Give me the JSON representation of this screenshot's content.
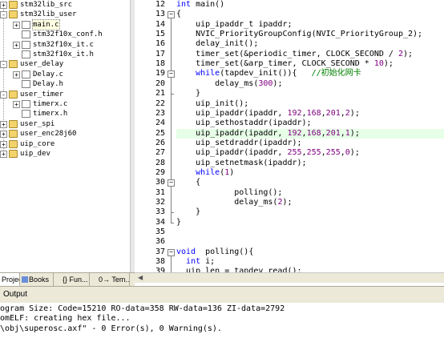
{
  "project_tree": [
    {
      "label": "stm32lib_src",
      "kind": "folder",
      "expand": "+",
      "depth": 0
    },
    {
      "label": "stm32lib_user",
      "kind": "folder",
      "expand": "-",
      "depth": 0
    },
    {
      "label": "main.c",
      "kind": "file",
      "expand": "+",
      "depth": 1,
      "selected": true
    },
    {
      "label": "stm32f10x_conf.h",
      "kind": "file",
      "expand": "",
      "depth": 1
    },
    {
      "label": "stm32f10x_it.c",
      "kind": "file",
      "expand": "+",
      "depth": 1
    },
    {
      "label": "stm32f10x_it.h",
      "kind": "file",
      "expand": "",
      "depth": 1
    },
    {
      "label": "user_delay",
      "kind": "folder",
      "expand": "-",
      "depth": 0
    },
    {
      "label": "Delay.c",
      "kind": "file",
      "expand": "+",
      "depth": 1
    },
    {
      "label": "Delay.h",
      "kind": "file",
      "expand": "",
      "depth": 1
    },
    {
      "label": "user_timer",
      "kind": "folder",
      "expand": "-",
      "depth": 0
    },
    {
      "label": "timerx.c",
      "kind": "file",
      "expand": "+",
      "depth": 1
    },
    {
      "label": "timerx.h",
      "kind": "file",
      "expand": "",
      "depth": 1
    },
    {
      "label": "user_spi",
      "kind": "folder",
      "expand": "+",
      "depth": 0
    },
    {
      "label": "user_enc28j60",
      "kind": "folder",
      "expand": "+",
      "depth": 0
    },
    {
      "label": "uip_core",
      "kind": "folder",
      "expand": "+",
      "depth": 0
    },
    {
      "label": "uip_dev",
      "kind": "folder",
      "expand": "+",
      "depth": 0
    }
  ],
  "panel_tabs": [
    {
      "label": "Project",
      "icon": "project-icon",
      "active": true
    },
    {
      "label": "Books",
      "icon": "books-icon",
      "active": false
    },
    {
      "label": "{} Fun...",
      "icon": "functions-icon",
      "active": false
    },
    {
      "label": "0→ Tem...",
      "icon": "templates-icon",
      "active": false
    }
  ],
  "editor": {
    "highlight_line": 25,
    "lines": [
      {
        "n": "12",
        "tokens": [
          [
            "kw",
            "int"
          ],
          [
            "t",
            " main()"
          ]
        ]
      },
      {
        "n": "13",
        "tokens": [
          [
            "t",
            "{"
          ]
        ]
      },
      {
        "n": "14",
        "tokens": [
          [
            "t",
            "    uip_ipaddr_t ipaddr;"
          ]
        ]
      },
      {
        "n": "15",
        "tokens": [
          [
            "t",
            "    NVIC_PriorityGroupConfig(NVIC_PriorityGroup_2);"
          ]
        ]
      },
      {
        "n": "16",
        "tokens": [
          [
            "t",
            "    delay_init();"
          ]
        ]
      },
      {
        "n": "17",
        "tokens": [
          [
            "t",
            "    timer_set(&periodic_timer, CLOCK_SECOND / "
          ],
          [
            "num",
            "2"
          ],
          [
            "t",
            ");"
          ]
        ]
      },
      {
        "n": "18",
        "tokens": [
          [
            "t",
            "    timer_set(&arp_timer, CLOCK_SECOND * "
          ],
          [
            "num",
            "10"
          ],
          [
            "t",
            ");"
          ]
        ]
      },
      {
        "n": "19",
        "tokens": [
          [
            "t",
            "    "
          ],
          [
            "kw",
            "while"
          ],
          [
            "t",
            "(tapdev_init()){   "
          ],
          [
            "cm",
            "//初始化网卡"
          ]
        ]
      },
      {
        "n": "20",
        "tokens": [
          [
            "t",
            "        delay_ms("
          ],
          [
            "num",
            "300"
          ],
          [
            "t",
            ");"
          ]
        ]
      },
      {
        "n": "21",
        "tokens": [
          [
            "t",
            "    }"
          ]
        ]
      },
      {
        "n": "22",
        "tokens": [
          [
            "t",
            "    uip_init();"
          ]
        ]
      },
      {
        "n": "23",
        "tokens": [
          [
            "t",
            "    uip_ipaddr(ipaddr, "
          ],
          [
            "num",
            "192"
          ],
          [
            "t",
            ","
          ],
          [
            "num",
            "168"
          ],
          [
            "t",
            ","
          ],
          [
            "num",
            "201"
          ],
          [
            "t",
            ","
          ],
          [
            "num",
            "2"
          ],
          [
            "t",
            ");"
          ]
        ]
      },
      {
        "n": "24",
        "tokens": [
          [
            "t",
            "    uip_sethostaddr(ipaddr);"
          ]
        ]
      },
      {
        "n": "25",
        "tokens": [
          [
            "t",
            "    uip_ipaddr(ipaddr, "
          ],
          [
            "num",
            "192"
          ],
          [
            "t",
            ","
          ],
          [
            "num",
            "168"
          ],
          [
            "t",
            ","
          ],
          [
            "num",
            "201"
          ],
          [
            "t",
            ","
          ],
          [
            "num",
            "1"
          ],
          [
            "t",
            ");"
          ]
        ]
      },
      {
        "n": "26",
        "tokens": [
          [
            "t",
            "    uip_setdraddr(ipaddr);"
          ]
        ]
      },
      {
        "n": "27",
        "tokens": [
          [
            "t",
            "    uip_ipaddr(ipaddr, "
          ],
          [
            "num",
            "255"
          ],
          [
            "t",
            ","
          ],
          [
            "num",
            "255"
          ],
          [
            "t",
            ","
          ],
          [
            "num",
            "255"
          ],
          [
            "t",
            ","
          ],
          [
            "num",
            "0"
          ],
          [
            "t",
            ");"
          ]
        ]
      },
      {
        "n": "28",
        "tokens": [
          [
            "t",
            "    uip_setnetmask(ipaddr);"
          ]
        ]
      },
      {
        "n": "29",
        "tokens": [
          [
            "t",
            "    "
          ],
          [
            "kw",
            "while"
          ],
          [
            "t",
            "("
          ],
          [
            "num",
            "1"
          ],
          [
            "t",
            ")"
          ]
        ]
      },
      {
        "n": "30",
        "tokens": [
          [
            "t",
            "    {"
          ]
        ]
      },
      {
        "n": "31",
        "tokens": [
          [
            "t",
            "            polling();"
          ]
        ]
      },
      {
        "n": "32",
        "tokens": [
          [
            "t",
            "            delay_ms("
          ],
          [
            "num",
            "2"
          ],
          [
            "t",
            ");"
          ]
        ]
      },
      {
        "n": "33",
        "tokens": [
          [
            "t",
            "    }"
          ]
        ]
      },
      {
        "n": "34",
        "tokens": [
          [
            "t",
            "}"
          ]
        ]
      },
      {
        "n": "35",
        "tokens": []
      },
      {
        "n": "36",
        "tokens": []
      },
      {
        "n": "37",
        "tokens": [
          [
            "kw",
            "void"
          ],
          [
            "t",
            "  polling(){"
          ]
        ]
      },
      {
        "n": "38",
        "tokens": [
          [
            "t",
            "  "
          ],
          [
            "kw",
            "int"
          ],
          [
            "t",
            " i;"
          ]
        ]
      },
      {
        "n": "39",
        "tokens": [
          [
            "t",
            "  uip_len = tapdev_read();"
          ]
        ]
      }
    ]
  },
  "output": {
    "title": "Output",
    "lines": [
      "ogram Size: Code=15210 RO-data=358 RW-data=136 ZI-data=2792",
      "omELF: creating hex file...",
      "\\obj\\superosc.axf\" - 0 Error(s), 0 Warning(s)."
    ]
  },
  "colors": {
    "keyword": "#0000ff",
    "number": "#800080",
    "comment": "#008000",
    "highlight": "#e6ffe6"
  }
}
